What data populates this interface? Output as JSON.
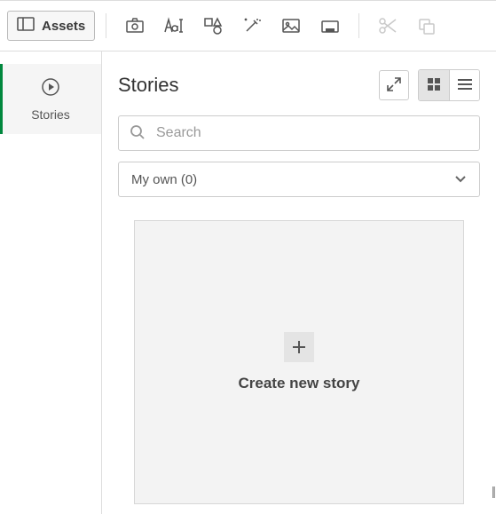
{
  "toolbar": {
    "assets_label": "Assets"
  },
  "sidebar": {
    "items": [
      {
        "label": "Stories"
      }
    ]
  },
  "main": {
    "title": "Stories",
    "search_placeholder": "Search",
    "filter_label": "My own (0)",
    "create_tile_label": "Create new story"
  }
}
